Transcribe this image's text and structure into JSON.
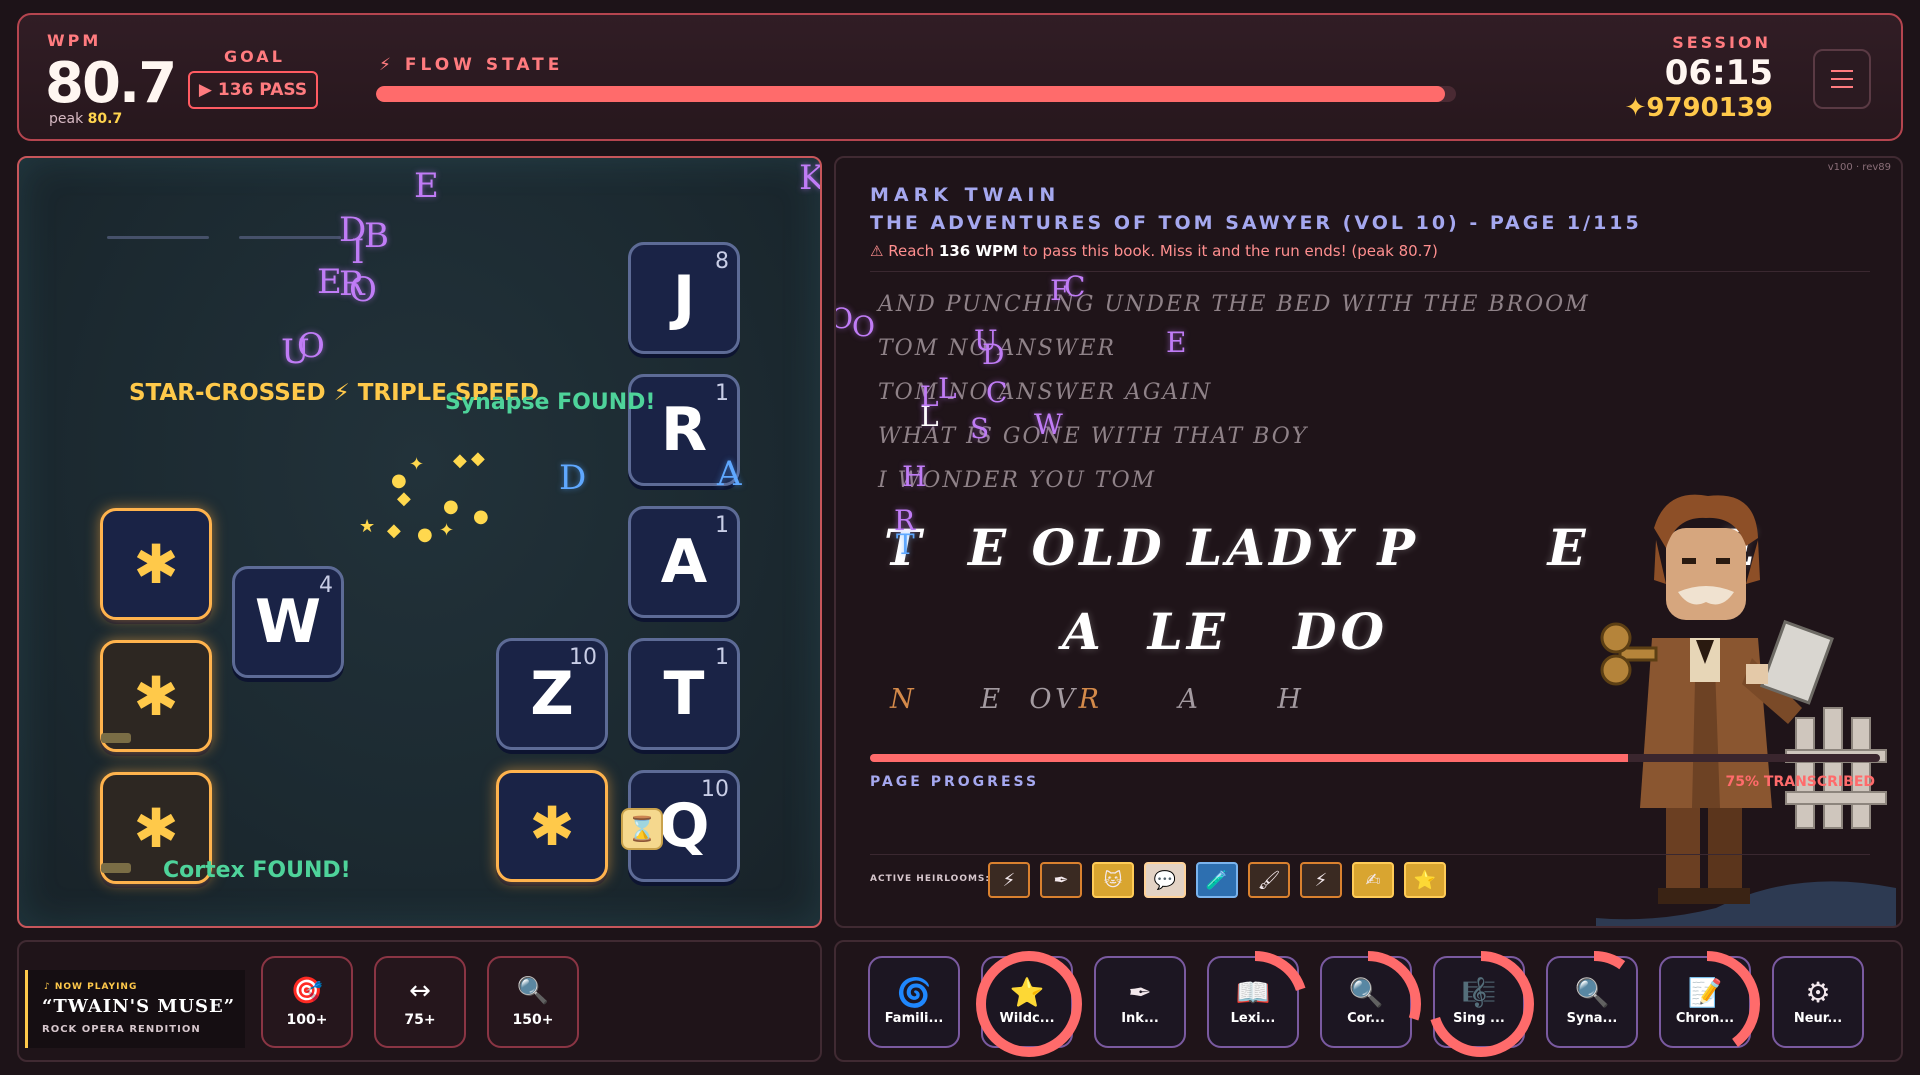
{
  "topbar": {
    "wpm_label": "WPM",
    "wpm_value": "80.7",
    "peak_label": "peak",
    "peak_value": "80.7",
    "goal_label": "GOAL",
    "goal_badge": "▶ 136 PASS",
    "flow_label": "FLOW STATE",
    "flow_progress": 0.99,
    "session_label": "SESSION",
    "session_time": "06:15",
    "score": "✦9790139"
  },
  "board": {
    "banner": "STAR-CROSSED ⚡ TRIPLE SPEED",
    "found_1": "Synapse FOUND!",
    "found_2": "Cortex FOUND!",
    "tiles": [
      {
        "letter": "J",
        "num": "8"
      },
      {
        "letter": "R",
        "num": "1"
      },
      {
        "letter": "A",
        "num": "1"
      },
      {
        "letter": "T",
        "num": "1"
      },
      {
        "letter": "Q",
        "num": "10"
      },
      {
        "letter": "Z",
        "num": "10"
      },
      {
        "letter": "W",
        "num": "4"
      },
      {
        "letter": "✱",
        "num": ""
      },
      {
        "letter": "✱",
        "num": ""
      },
      {
        "letter": "✱",
        "num": ""
      },
      {
        "letter": "✱",
        "num": ""
      }
    ],
    "floating_letters": [
      "E",
      "K",
      "D",
      "B",
      "I",
      "E",
      "R",
      "O",
      "U",
      "O",
      "D",
      "A"
    ],
    "hourglass": "⌛"
  },
  "book": {
    "version": "v100 · rev89",
    "author": "MARK TWAIN",
    "title": "THE ADVENTURES OF TOM SAWYER (VOL 10) - PAGE 1/115",
    "warning_prefix": "⚠ Reach ",
    "warning_goal": "136 WPM",
    "warning_suffix": " to pass this book. Miss it and the run ends! (peak 80.7)",
    "done_lines": [
      "AND PUNCHING UNDER THE BED WITH THE BROOM",
      "TOM NO ANSWER",
      "TOM NO ANSWER AGAIN",
      "WHAT IS GONE WITH THAT BOY",
      "I WONDER YOU TOM"
    ],
    "current_line_1": "T  E OLD LADY P      E      E",
    "current_line_2": "A  LE   DO",
    "next_line_a": "N",
    "next_line_b": "     E  OV",
    "next_line_c": "R",
    "next_line_d": "      A      H",
    "floating_letters": [
      "F",
      "C",
      "O",
      "O",
      "U",
      "D",
      "E",
      "L",
      "C",
      "L",
      "S",
      "W",
      "L",
      "H",
      "R",
      "T"
    ],
    "page_progress": 0.75,
    "page_label": "PAGE PROGRESS",
    "page_pct": "75% TRANSCRIBED",
    "heirloom_label": "ACTIVE HEIRLOOMS:",
    "heirlooms": [
      "⚡",
      "✒",
      "🐱",
      "💬",
      "🧪",
      "🖌",
      "⚡",
      "✍",
      "⭐"
    ]
  },
  "now_playing": {
    "label": "♪ NOW PLAYING",
    "title": "“TWAIN'S MUSE”",
    "subtitle": "ROCK OPERA RENDITION"
  },
  "powerups": [
    {
      "icon": "🎯",
      "label": "100+"
    },
    {
      "icon": "↔",
      "label": "75+"
    },
    {
      "icon": "🔍",
      "label": "150+"
    }
  ],
  "skills": [
    {
      "icon": "🌀",
      "label": "Famili...",
      "cooldown": 0
    },
    {
      "icon": "⭐",
      "label": "Wildc...",
      "cooldown": 1
    },
    {
      "icon": "✒",
      "label": "Ink...",
      "cooldown": 0
    },
    {
      "icon": "📖",
      "label": "Lexi...",
      "cooldown": 0.2
    },
    {
      "icon": "🔍",
      "label": "Cor...",
      "cooldown": 0.3
    },
    {
      "icon": "🎼",
      "label": "Sing ...",
      "cooldown": 0.7
    },
    {
      "icon": "🔍",
      "label": "Syna...",
      "cooldown": 0.1
    },
    {
      "icon": "📝",
      "label": "Chron...",
      "cooldown": 0.4
    },
    {
      "icon": "⚙",
      "label": "Neur...",
      "cooldown": 0
    }
  ],
  "colors": {
    "accent": "#ff6b6b",
    "gold": "#ffc94a",
    "violet": "#c07cf6",
    "lavender": "#a5a8ef"
  }
}
